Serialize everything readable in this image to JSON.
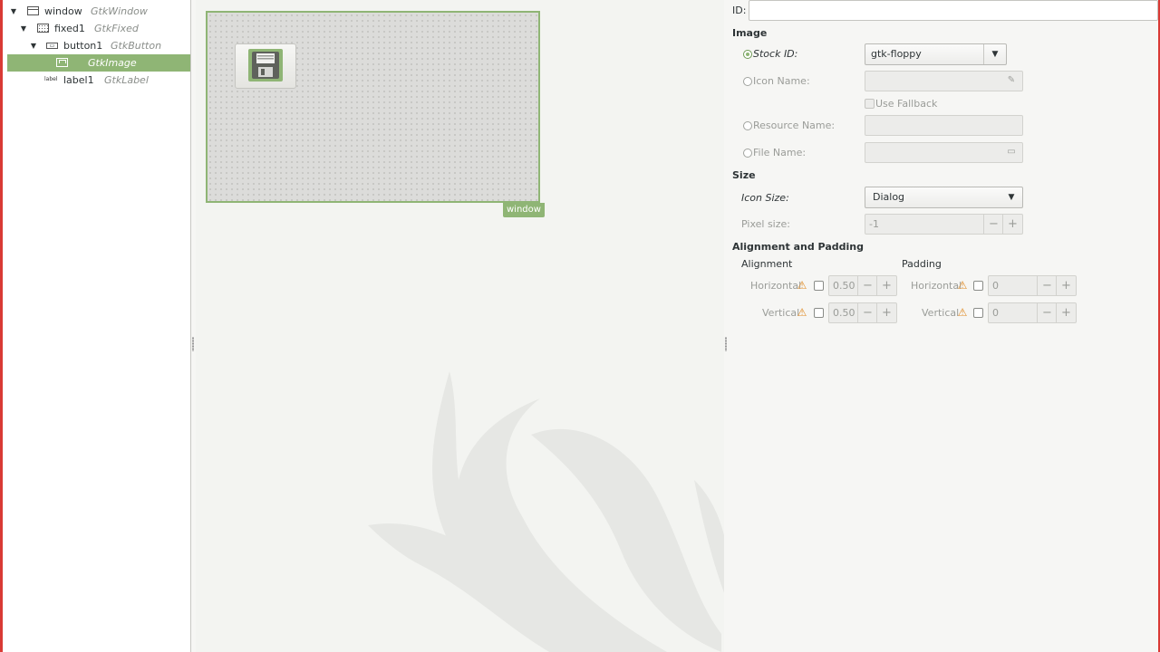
{
  "tree": {
    "items": [
      {
        "name": "window",
        "type": "GtkWindow"
      },
      {
        "name": "fixed1",
        "type": "GtkFixed"
      },
      {
        "name": "button1",
        "type": "GtkButton"
      },
      {
        "name": "",
        "type": "GtkImage"
      },
      {
        "name": "label1",
        "type": "GtkLabel"
      }
    ],
    "label_icon_text": "label"
  },
  "canvas": {
    "window_label": "window"
  },
  "props": {
    "id_label": "ID:",
    "id_value": "",
    "image_header": "Image",
    "stock_id_label": "Stock ID:",
    "stock_id_value": "gtk-floppy",
    "icon_name_label": "Icon Name:",
    "use_fallback_label": "Use Fallback",
    "resource_name_label": "Resource Name:",
    "file_name_label": "File Name:",
    "size_header": "Size",
    "icon_size_label": "Icon Size:",
    "icon_size_value": "Dialog",
    "pixel_size_label": "Pixel size:",
    "pixel_size_value": "-1",
    "align_header": "Alignment and Padding",
    "alignment_label": "Alignment",
    "padding_label": "Padding",
    "horizontal_label": "Horizontal",
    "vertical_label": "Vertical",
    "align_h_value": "0.50",
    "align_v_value": "0.50",
    "pad_h_value": "0",
    "pad_v_value": "0",
    "minus": "−",
    "plus": "+"
  },
  "colors": {
    "accent": "#8fb575",
    "edge": "#d93a35",
    "warning": "#e08b25"
  }
}
